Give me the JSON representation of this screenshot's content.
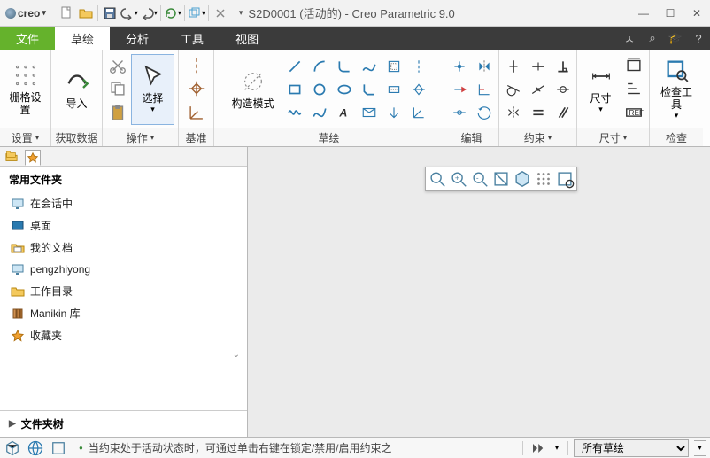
{
  "logo": "creo",
  "title": "S2D0001 (活动的) - Creo Parametric 9.0",
  "tabs": {
    "file": "文件",
    "sketch": "草绘",
    "analysis": "分析",
    "tools": "工具",
    "view": "视图"
  },
  "ribbon": {
    "grid_group": "设置",
    "grid_btn": "栅格设置",
    "data_group": "获取数据",
    "import_btn": "导入",
    "op_group": "操作",
    "select_btn": "选择",
    "datum_group": "基准",
    "constr_mode": "构造模式",
    "sketch_group": "草绘",
    "edit_group": "编辑",
    "constraint_group": "约束",
    "dim_group": "尺寸",
    "dim_btn": "尺寸",
    "inspect_group": "检查",
    "inspect_btn": "检查工具"
  },
  "folders": {
    "header": "常用文件夹",
    "items": [
      {
        "label": "在会话中",
        "icon": "monitor"
      },
      {
        "label": "桌面",
        "icon": "desktop"
      },
      {
        "label": "我的文档",
        "icon": "docs"
      },
      {
        "label": "pengzhiyong",
        "icon": "monitor"
      },
      {
        "label": "工作目录",
        "icon": "folder"
      },
      {
        "label": "Manikin 库",
        "icon": "lib"
      },
      {
        "label": "收藏夹",
        "icon": "star"
      }
    ],
    "tree": "文件夹树"
  },
  "status": {
    "msg": "当约束处于活动状态时，可通过单击右键在锁定/禁用/启用约束之",
    "filter": "所有草绘"
  }
}
